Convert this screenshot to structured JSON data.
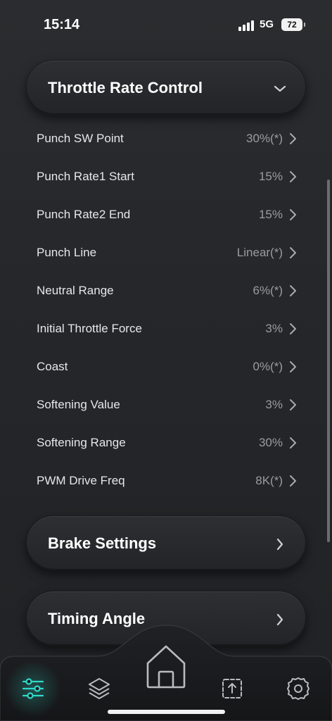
{
  "status_bar": {
    "time": "15:14",
    "network": "5G",
    "battery": "72"
  },
  "sections": {
    "throttle": {
      "title": "Throttle Rate Control",
      "expanded": true
    },
    "brake": {
      "title": "Brake Settings"
    },
    "timing": {
      "title": "Timing Angle"
    }
  },
  "settings": [
    {
      "label": "Punch SW Point",
      "value": "30%(*)"
    },
    {
      "label": "Punch Rate1 Start",
      "value": "15%"
    },
    {
      "label": "Punch Rate2 End",
      "value": "15%"
    },
    {
      "label": "Punch Line",
      "value": "Linear(*)"
    },
    {
      "label": "Neutral Range",
      "value": "6%(*)"
    },
    {
      "label": "Initial Throttle Force",
      "value": "3%"
    },
    {
      "label": "Coast",
      "value": "0%(*)"
    },
    {
      "label": "Softening Value",
      "value": "3%"
    },
    {
      "label": "Softening Range",
      "value": "30%"
    },
    {
      "label": "PWM Drive Freq",
      "value": "8K(*)"
    }
  ],
  "nav": {
    "items": [
      {
        "icon": "sliders-icon",
        "active": true
      },
      {
        "icon": "layers-icon",
        "active": false
      },
      {
        "icon": "home-icon",
        "active": false
      },
      {
        "icon": "upload-icon",
        "active": false
      },
      {
        "icon": "gear-icon",
        "active": false
      }
    ],
    "active_color": "#2fd9c8"
  },
  "colors": {
    "text": "#e6e7e9",
    "value": "#9a9ca0",
    "accent": "#2fd9c8",
    "background": "#25272a"
  }
}
